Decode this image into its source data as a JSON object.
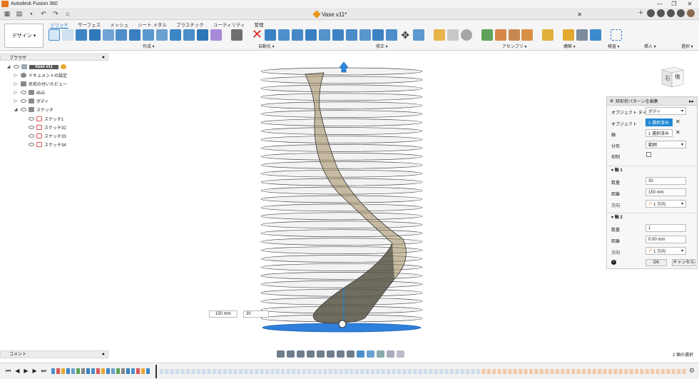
{
  "window": {
    "title": "Autodesk Fusion 360",
    "controls": [
      "—",
      "❐",
      "✕"
    ]
  },
  "document_tab": {
    "name": "Vase v11*",
    "close": "✕"
  },
  "workspace": {
    "label": "デザイン ▾"
  },
  "tabs": [
    {
      "label": "ソリッド",
      "active": true
    },
    {
      "label": "サーフェス"
    },
    {
      "label": "メッシュ"
    },
    {
      "label": "シート メタル"
    },
    {
      "label": "プラスチック"
    },
    {
      "label": "ユーティリティ"
    },
    {
      "label": "管理"
    }
  ],
  "tool_groups": {
    "create": "作成 ▾",
    "automate": "自動化 ▾",
    "modify": "修正 ▾",
    "assemble": "アセンブリ ▾",
    "construct": "構築 ▾",
    "inspect": "検査 ▾",
    "insert": "挿入 ▾",
    "select": "選択 ▾"
  },
  "browser": {
    "title": "ブラウザ",
    "root": "Vase v11",
    "items": [
      {
        "label": "ドキュメントの設定",
        "icon": "gear-icon"
      },
      {
        "label": "名前の付いたビュー",
        "icon": "folder-icon"
      },
      {
        "label": "原点",
        "icon": "folder-icon"
      },
      {
        "label": "ボディ",
        "icon": "folder-icon"
      },
      {
        "label": "スケッチ",
        "icon": "folder-icon"
      }
    ],
    "sketches": [
      "スケッチ1",
      "スケッチ32",
      "スケッチ33",
      "スケッチ34"
    ]
  },
  "panel": {
    "title": "矩形状パターンを編集",
    "object_type": {
      "label": "オブジェクト タイプ",
      "value": "ボディ"
    },
    "objects": {
      "label": "オブジェクト",
      "value": "1 選択済み"
    },
    "axis": {
      "label": "軸",
      "value": "1 選択済み"
    },
    "distribution": {
      "label": "分布",
      "value": "範囲"
    },
    "suppress": {
      "label": "抑制"
    },
    "axis1": {
      "title": "軸 1",
      "count_label": "数量",
      "count": "30",
      "distance_label": "距離",
      "distance": "150 mm",
      "direction_label": "方向",
      "direction": "1 方向"
    },
    "axis2": {
      "title": "軸 2",
      "count_label": "数量",
      "count": "1",
      "distance_label": "距離",
      "distance": "0.00 mm",
      "direction_label": "方向",
      "direction": "1 方向"
    },
    "ok": "OK",
    "cancel": "キャンセル"
  },
  "viewport": {
    "distance_input": "150 mm",
    "count_input": "30",
    "ring_count": 30
  },
  "viewcube": {
    "right": "右",
    "back": "後"
  },
  "comment": "コメント",
  "status": "2 個の選択",
  "colors": {
    "accent": "#0a6ccf",
    "selection_blue": "#1e88d4",
    "body_brown": "#a08c5e"
  }
}
